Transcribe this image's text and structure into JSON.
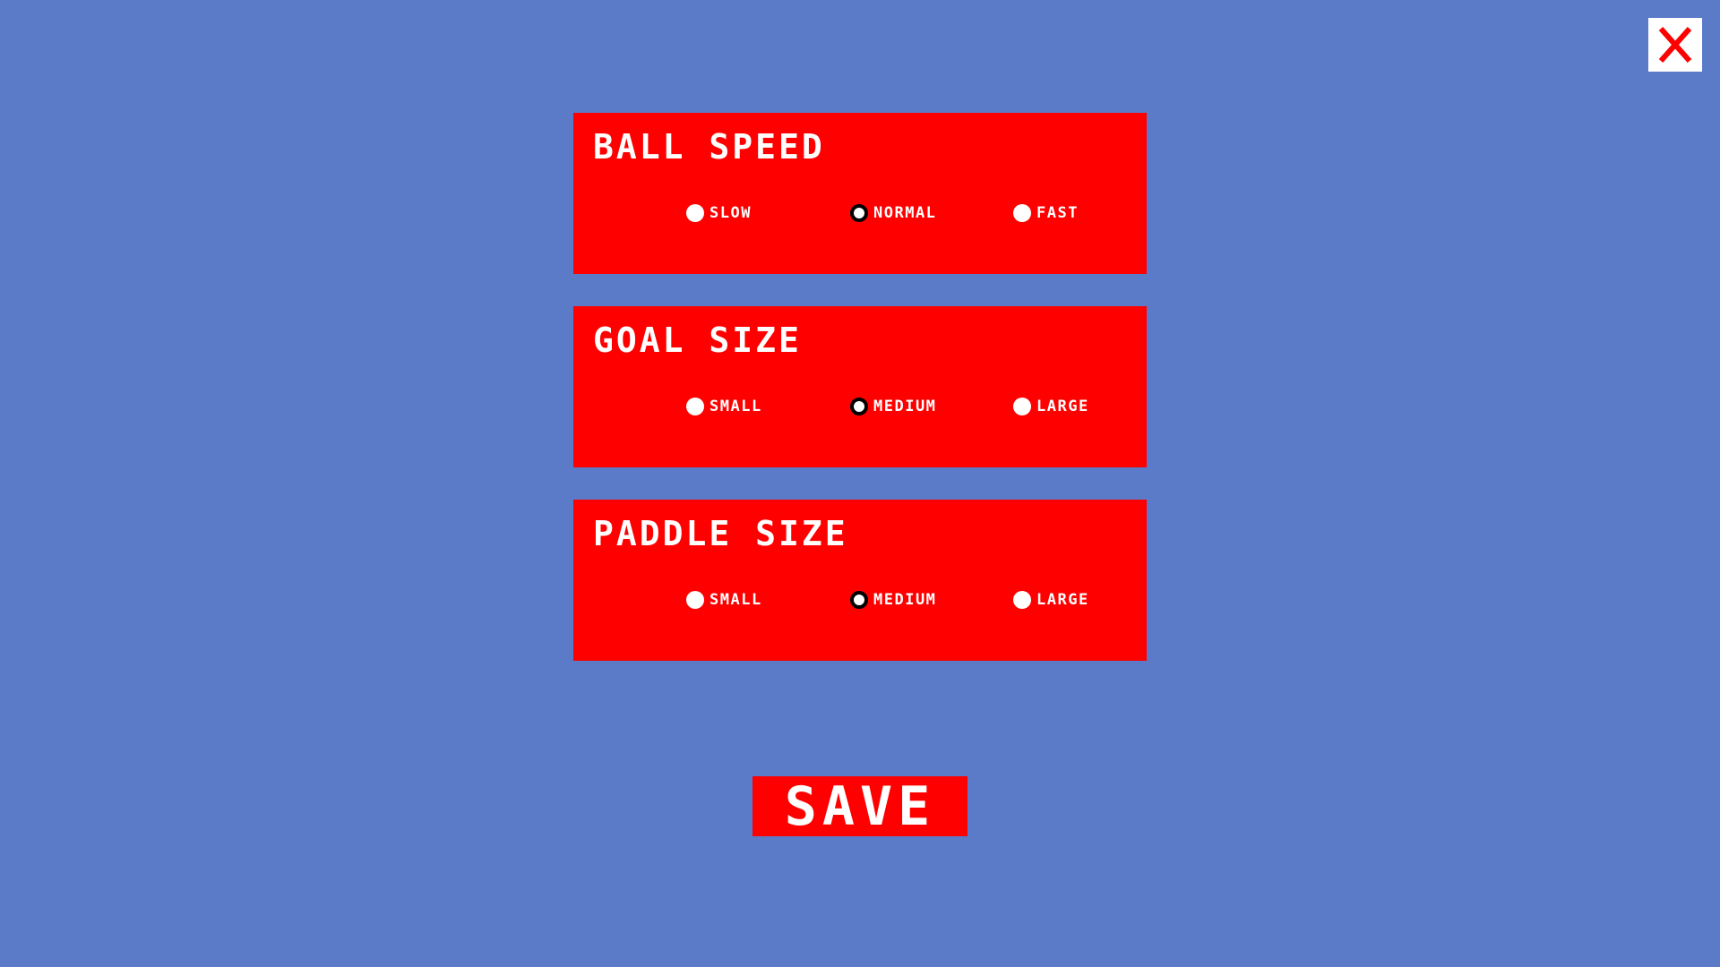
{
  "close_button": {
    "icon": "close-x-icon",
    "icon_color": "#ff0000",
    "background": "#ffffff"
  },
  "settings": {
    "ball_speed": {
      "title": "BALL SPEED",
      "options": [
        {
          "label": "SLOW",
          "selected": false
        },
        {
          "label": "NORMAL",
          "selected": true
        },
        {
          "label": "FAST",
          "selected": false
        }
      ]
    },
    "goal_size": {
      "title": "GOAL SIZE",
      "options": [
        {
          "label": "SMALL",
          "selected": false
        },
        {
          "label": "MEDIUM",
          "selected": true
        },
        {
          "label": "LARGE",
          "selected": false
        }
      ]
    },
    "paddle_size": {
      "title": "PADDLE SIZE",
      "options": [
        {
          "label": "SMALL",
          "selected": false
        },
        {
          "label": "MEDIUM",
          "selected": true
        },
        {
          "label": "LARGE",
          "selected": false
        }
      ]
    }
  },
  "save_button": {
    "label": "SAVE"
  },
  "colors": {
    "background": "#5b7ac8",
    "panel": "#ff0000",
    "text": "#ffffff",
    "radio_selected_ring": "#000000"
  }
}
